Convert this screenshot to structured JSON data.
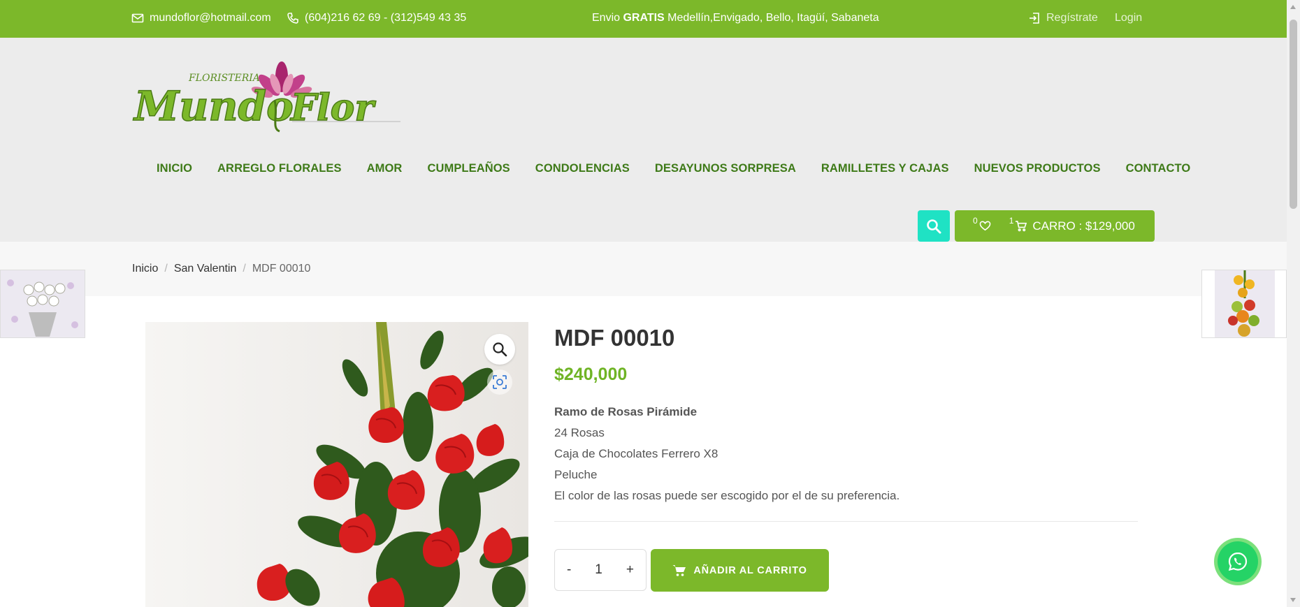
{
  "topbar": {
    "email": "mundoflor@hotmail.com",
    "phones": "(604)216 62 69 - (312)549 43 35",
    "shipping_prefix": "Envio ",
    "shipping_bold": "GRATIS",
    "shipping_suffix": " Medellín,Envigado, Bello, Itagüí, Sabaneta",
    "register": "Regístrate",
    "login": "Login"
  },
  "logo": {
    "small_text": "FLORISTERIA",
    "word_1": "Mundo",
    "word_2": "Flor"
  },
  "nav": [
    "INICIO",
    "ARREGLO FLORALES",
    "AMOR",
    "CUMPLEAÑOS",
    "CONDOLENCIAS",
    "DESAYUNOS SORPRESA",
    "RAMILLETES Y CAJAS",
    "NUEVOS PRODUCTOS",
    "CONTACTO"
  ],
  "cart": {
    "wishlist_count": "0",
    "cart_count": "1",
    "label": "CARRO : $129,000"
  },
  "breadcrumb": {
    "home": "Inicio",
    "category": "San Valentin",
    "current": "MDF 00010",
    "separator": "/"
  },
  "product": {
    "title": "MDF 00010",
    "price": "$240,000",
    "desc_title": "Ramo de Rosas Pirámide",
    "desc_lines": [
      "24 Rosas",
      "Caja de Chocolates Ferrero X8",
      "Peluche",
      "El color de las rosas puede ser escogido por el de su preferencia."
    ],
    "qty_minus": "-",
    "qty_value": "1",
    "qty_plus": "+",
    "add_to_cart": "AÑADIR AL CARRITO"
  },
  "colors": {
    "brand_green": "#7cb82a",
    "nav_green": "#3e7a18",
    "price_green": "#6fb425",
    "search_teal": "#1fe2c4",
    "whatsapp_green": "#25d366"
  },
  "icons": [
    "mail-icon",
    "phone-icon",
    "login-icon",
    "search-icon",
    "heart-icon",
    "cart-icon",
    "zoom-icon",
    "scan-icon",
    "whatsapp-icon"
  ]
}
